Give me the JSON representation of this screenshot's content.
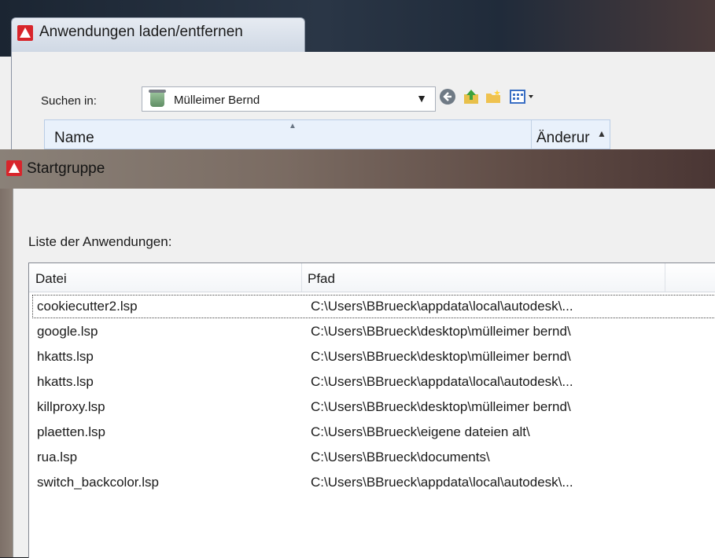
{
  "back_dialog": {
    "title": "Anwendungen laden/entfernen",
    "look_in_label": "Suchen in:",
    "look_in_value": "Mülleimer Bernd",
    "columns": [
      "Name",
      "Änderur"
    ]
  },
  "front_dialog": {
    "title": "Startgruppe",
    "list_label": "Liste der Anwendungen:",
    "columns": [
      "Datei",
      "Pfad"
    ],
    "rows": [
      {
        "file": "cookiecutter2.lsp",
        "path": "C:\\Users\\BBrueck\\appdata\\local\\autodesk\\..."
      },
      {
        "file": "google.lsp",
        "path": "C:\\Users\\BBrueck\\desktop\\mülleimer bernd\\"
      },
      {
        "file": "hkatts.lsp",
        "path": "C:\\Users\\BBrueck\\desktop\\mülleimer bernd\\"
      },
      {
        "file": "hkatts.lsp",
        "path": "C:\\Users\\BBrueck\\appdata\\local\\autodesk\\..."
      },
      {
        "file": "killproxy.lsp",
        "path": "C:\\Users\\BBrueck\\desktop\\mülleimer bernd\\"
      },
      {
        "file": "plaetten.lsp",
        "path": "C:\\Users\\BBrueck\\eigene dateien alt\\"
      },
      {
        "file": "rua.lsp",
        "path": "C:\\Users\\BBrueck\\documents\\"
      },
      {
        "file": "switch_backcolor.lsp",
        "path": "C:\\Users\\BBrueck\\appdata\\local\\autodesk\\..."
      }
    ]
  },
  "icons": {
    "app": "autocad-icon",
    "back": "back-arrow-icon",
    "up": "up-folder-icon",
    "new_folder": "new-folder-icon",
    "views": "views-menu-icon"
  },
  "colors": {
    "app_icon": "#d8252b",
    "header_highlight": "#e9f1fb"
  }
}
